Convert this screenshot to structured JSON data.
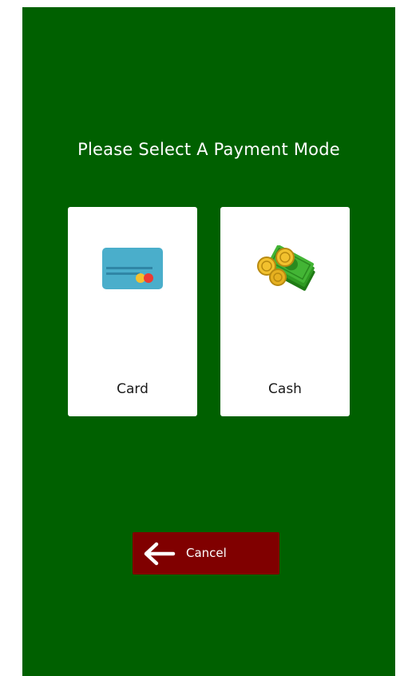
{
  "title": "Please Select A Payment Mode",
  "options": [
    {
      "label": "Card",
      "icon": "credit-card-icon"
    },
    {
      "label": "Cash",
      "icon": "cash-money-icon"
    }
  ],
  "cancel": {
    "label": "Cancel",
    "icon": "arrow-left-icon"
  },
  "colors": {
    "background": "#006000",
    "card": "#ffffff",
    "cancel_button": "#800000",
    "text_light": "#ffffff",
    "text_dark": "#1a1a1a"
  }
}
